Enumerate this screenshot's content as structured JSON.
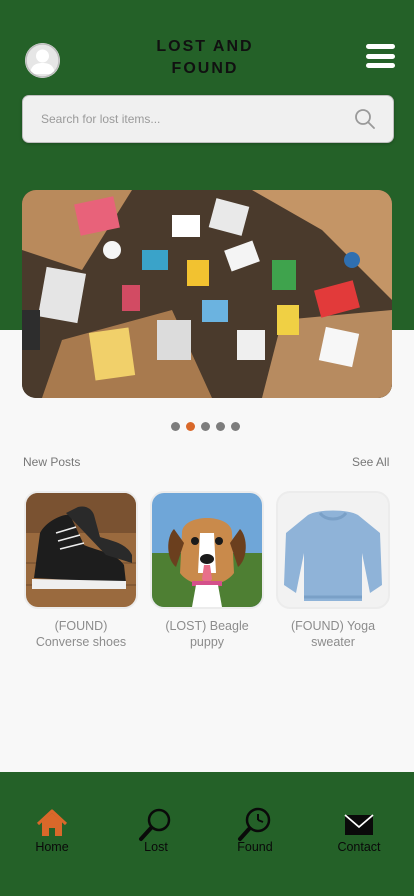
{
  "header": {
    "title": "LOST AND\nFOUND",
    "avatar": "user-avatar-icon",
    "menu": "hamburger-menu-icon"
  },
  "search": {
    "placeholder": "Search for lost items...",
    "value": "",
    "icon": "search-icon"
  },
  "carousel": {
    "slide_count": 5,
    "active_index": 1
  },
  "posts": {
    "section_title": "New Posts",
    "see_all_label": "See All",
    "items": [
      {
        "caption": "(FOUND)\nConverse shoes",
        "image": "black-high-top-sneakers"
      },
      {
        "caption": "(LOST) Beagle\npuppy",
        "image": "beagle-puppy"
      },
      {
        "caption": "(FOUND) Yoga\nsweater",
        "image": "light-blue-sweater"
      }
    ]
  },
  "bottom_nav": {
    "items": [
      {
        "label": "Home",
        "icon": "home-icon",
        "active": true
      },
      {
        "label": "Lost",
        "icon": "magnifier-icon",
        "active": false
      },
      {
        "label": "Found",
        "icon": "magnifier-clock-icon",
        "active": false
      },
      {
        "label": "Contact",
        "icon": "envelope-icon",
        "active": false
      }
    ]
  },
  "colors": {
    "brand_green": "#246128",
    "accent_orange": "#d9682a",
    "background": "#f8f8f8"
  }
}
